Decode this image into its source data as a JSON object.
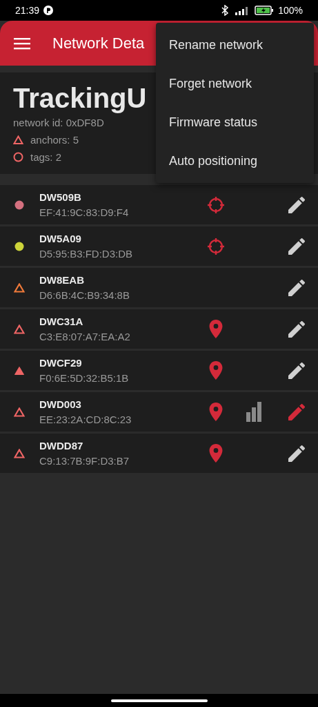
{
  "status_bar": {
    "time": "21:39",
    "battery": "100%"
  },
  "toolbar": {
    "title": "Network Deta"
  },
  "network": {
    "name": "TrackingU",
    "id": "network id: 0xDF8D",
    "anchors": "anchors: 5",
    "tags": "tags: 2"
  },
  "devices": [
    {
      "kind": "tag",
      "name": "DW509B",
      "address": "EF:41:9C:83:D9:F4",
      "color": "#d4707f",
      "filled": true,
      "locate": {
        "kind": "target"
      },
      "signal": false,
      "edit_active": false
    },
    {
      "kind": "tag",
      "name": "DW5A09",
      "address": "D5:95:B3:FD:D3:DB",
      "color": "#cdd43a",
      "filled": true,
      "locate": {
        "kind": "target"
      },
      "signal": false,
      "edit_active": false
    },
    {
      "kind": "anchor",
      "name": "DW8EAB",
      "address": "D6:6B:4C:B9:34:8B",
      "color": "#f07a3a",
      "filled": false,
      "signal": false,
      "edit_active": false
    },
    {
      "kind": "anchor",
      "name": "DWC31A",
      "address": "C3:E8:07:A7:EA:A2",
      "color": "#ef6565",
      "filled": false,
      "locate": {
        "kind": "pin"
      },
      "signal": false,
      "edit_active": false
    },
    {
      "kind": "anchor",
      "name": "DWCF29",
      "address": "F0:6E:5D:32:B5:1B",
      "color": "#ef6565",
      "filled": true,
      "locate": {
        "kind": "pin"
      },
      "signal": false,
      "edit_active": false
    },
    {
      "kind": "anchor",
      "name": "DWD003",
      "address": "EE:23:2A:CD:8C:23",
      "color": "#ef6565",
      "filled": false,
      "locate": {
        "kind": "pin"
      },
      "signal": true,
      "edit_active": true
    },
    {
      "kind": "anchor",
      "name": "DWDD87",
      "address": "C9:13:7B:9F:D3:B7",
      "color": "#ef6565",
      "filled": false,
      "locate": {
        "kind": "pin"
      },
      "signal": false,
      "edit_active": false
    }
  ],
  "menu": {
    "items": [
      "Rename network",
      "Forget network",
      "Firmware status",
      "Auto positioning"
    ]
  }
}
